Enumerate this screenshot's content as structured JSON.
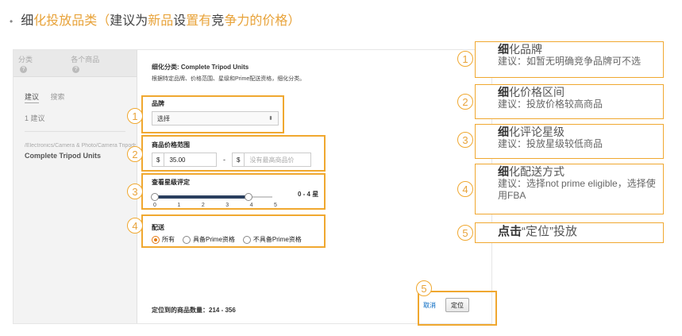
{
  "slide": {
    "bullet": "•",
    "title_a": "细",
    "title_b": "化投放品类（",
    "title_c": "建议为",
    "title_d": "新品",
    "title_e": "设",
    "title_f": "置有",
    "title_g": "竞",
    "title_h": "争力的价格）"
  },
  "screen": {
    "left": {
      "tab1": "分类",
      "tab2": "各个商品",
      "subtab_active": "建议",
      "subtab2": "搜索",
      "suggest_count": "1 建议",
      "category_path": "/Electronics/Camera & Photo/Camera Tripods",
      "category_name": "Complete Tripod Units"
    },
    "main": {
      "heading": "细化分类: Complete Tripod Units",
      "desc": "根据特定品牌、价格范围、星级和Prime配送资格，细化分类。",
      "brand_label": "品牌",
      "brand_value": "选择",
      "brand_arrow": "⬍",
      "price_label": "商品价格范围",
      "currency": "$",
      "price_min": "35.00",
      "price_dash": "-",
      "price_max_placeholder": "没有最高商品价",
      "star_label": "查看星级评定",
      "star_range": "0 - 4 星",
      "star_value_min": 0,
      "star_value_max": 4,
      "ticks": [
        "0",
        "1",
        "2",
        "3",
        "4",
        "5"
      ],
      "ship_label": "配送",
      "ship_options": [
        "所有",
        "具备Prime资格",
        "不具备Prime资格"
      ],
      "ship_selected": 0,
      "result_count": "定位到的商品数量：214 - 356",
      "cancel": "取消",
      "target": "定位"
    }
  },
  "markers": [
    "1",
    "2",
    "3",
    "4",
    "5"
  ],
  "notes": [
    {
      "n": "1",
      "h1": "细",
      "h2": "化品牌",
      "s": "建议：如暂无明确竞争品牌可不选"
    },
    {
      "n": "2",
      "h1": "细",
      "h2": "化价格区间",
      "s": "建议：投放价格较高商品"
    },
    {
      "n": "3",
      "h1": "细",
      "h2": "化评论星级",
      "s": "建议：投放星级较低商品"
    },
    {
      "n": "4",
      "h1": "细",
      "h2": "化配送方式",
      "s": "建议：选择not prime eligible，选择使用FBA"
    },
    {
      "n": "5",
      "h1": "点击",
      "h2": "“定位”投放",
      "s": ""
    }
  ],
  "colors": {
    "accent": "#f0a830",
    "amazon_orange": "#e47911",
    "link": "#0066c0"
  }
}
